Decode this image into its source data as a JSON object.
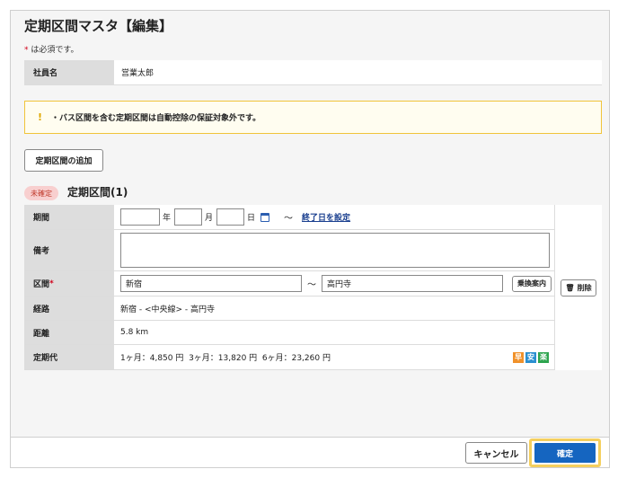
{
  "page": {
    "title": "定期区間マスタ【編集】",
    "required_mark": "*",
    "required_note": " は必須です。"
  },
  "employee": {
    "label": "社員名",
    "value": "営業太郎"
  },
  "warning": {
    "icon": "!",
    "text": "・バス区間を含む定期区間は自動控除の保証対象外です。"
  },
  "add_button": "定期区間の追加",
  "section": {
    "badge": "未確定",
    "title": "定期区間(1)",
    "rows": {
      "period": {
        "label": "期間",
        "year_unit": "年",
        "month_unit": "月",
        "day_unit": "日",
        "tilde": "〜",
        "end_link": "終了日を設定"
      },
      "remarks": {
        "label": "備考"
      },
      "segment": {
        "label": "区間",
        "required_mark": "*",
        "from": "新宿",
        "tilde": "〜",
        "to": "高円寺",
        "route_button": "乗換案内"
      },
      "route": {
        "label": "経路",
        "value": "新宿 - <中央線> - 高円寺"
      },
      "distance": {
        "label": "距離",
        "value": "5.8 km"
      },
      "fare": {
        "label": "定期代",
        "value": "1ヶ月：4,850 円  3ヶ月：13,820 円  6ヶ月：23,260 円",
        "icons": [
          {
            "char": "早",
            "color": "#f0912a"
          },
          {
            "char": "安",
            "color": "#2a8fd0"
          },
          {
            "char": "楽",
            "color": "#2da44e"
          }
        ]
      }
    },
    "delete_button": "削除"
  },
  "footer": {
    "cancel": "キャンセル",
    "confirm": "確定"
  }
}
